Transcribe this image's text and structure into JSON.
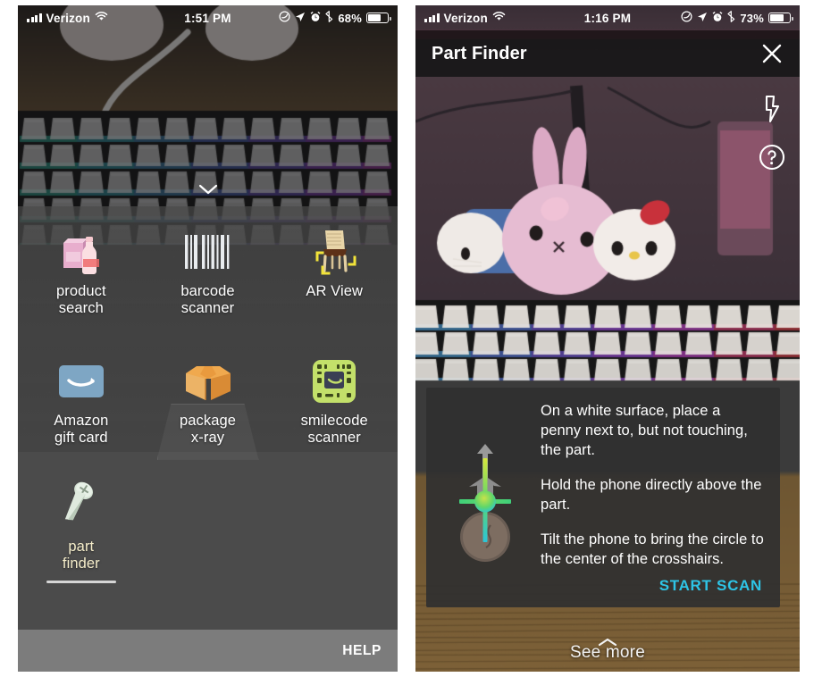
{
  "left_phone": {
    "status_bar": {
      "carrier": "Verizon",
      "time": "1:51 PM",
      "battery_percent": "68%",
      "icons": [
        "signal-bars-icon",
        "wifi-icon",
        "do-not-disturb-icon",
        "location-arrow-icon",
        "alarm-clock-icon",
        "bluetooth-icon",
        "battery-icon"
      ]
    },
    "chevron_icon": "chevron-down-icon",
    "modes": [
      {
        "id": "product-search",
        "label_line1": "product",
        "label_line2": "search",
        "icon": "grocery-box-bottle-icon",
        "selected": false
      },
      {
        "id": "barcode-scanner",
        "label_line1": "barcode",
        "label_line2": "scanner",
        "icon": "barcode-icon",
        "selected": false
      },
      {
        "id": "ar-view",
        "label_line1": "AR View",
        "label_line2": "",
        "icon": "ar-chair-icon",
        "selected": false
      },
      {
        "id": "amazon-gift-card",
        "label_line1": "Amazon",
        "label_line2": "gift card",
        "icon": "amazon-gift-card-icon",
        "selected": false
      },
      {
        "id": "package-x-ray",
        "label_line1": "package",
        "label_line2": "x-ray",
        "icon": "cardboard-box-icon",
        "selected": false
      },
      {
        "id": "smilecode-scanner",
        "label_line1": "smilecode",
        "label_line2": "scanner",
        "icon": "smilecode-icon",
        "selected": false
      },
      {
        "id": "part-finder",
        "label_line1": "part",
        "label_line2": "finder",
        "icon": "screw-icon",
        "selected": true
      }
    ],
    "help_label": "HELP"
  },
  "right_phone": {
    "status_bar": {
      "carrier": "Verizon",
      "time": "1:16 PM",
      "battery_percent": "73%",
      "icons": [
        "signal-bars-icon",
        "wifi-icon",
        "do-not-disturb-icon",
        "location-arrow-icon",
        "alarm-clock-icon",
        "bluetooth-icon",
        "battery-icon"
      ]
    },
    "header": {
      "title": "Part Finder",
      "close_icon": "close-icon"
    },
    "side_controls": [
      {
        "id": "flash",
        "icon": "flash-bolt-icon"
      },
      {
        "id": "help",
        "icon": "question-mark-circle-icon"
      }
    ],
    "instructions": {
      "diagram_icon": "crosshair-penny-level-icon",
      "steps": [
        "On a white surface, place a penny next to, but not touching, the part.",
        "Hold the phone directly above the part.",
        "Tilt the phone to bring the circle to the center of the crosshairs."
      ],
      "primary_action": "START SCAN",
      "primary_action_color": "#2ec4e6"
    },
    "see_more": {
      "label": "See more",
      "icon": "chevron-up-icon"
    }
  }
}
